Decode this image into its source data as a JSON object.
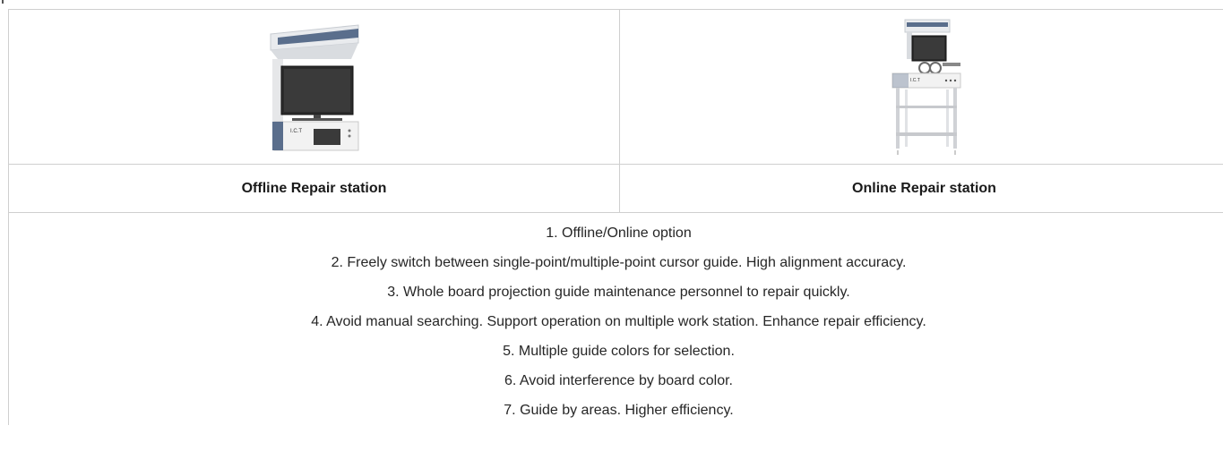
{
  "products": [
    {
      "name": "Offline Repair station",
      "image_icon": "offline-repair-station-image",
      "brand_plate": "I.C.T"
    },
    {
      "name": "Online Repair station",
      "image_icon": "online-repair-station-image",
      "brand_plate": "I.C.T"
    }
  ],
  "features": [
    "1. Offline/Online option",
    "2. Freely switch between single-point/multiple-point cursor guide. High alignment accuracy.",
    "3. Whole board projection guide maintenance personnel to repair quickly.",
    "4. Avoid manual searching. Support operation on multiple work station. Enhance repair efficiency.",
    "5. Multiple guide colors for selection.",
    "6. Avoid interference by board color.",
    "7. Guide by areas. Higher efficiency."
  ],
  "colors": {
    "border": "#cfcfcf",
    "accent_blue": "#5a6e8c",
    "machine_white": "#f2f2f2",
    "screen_dark": "#2b2b2b"
  }
}
